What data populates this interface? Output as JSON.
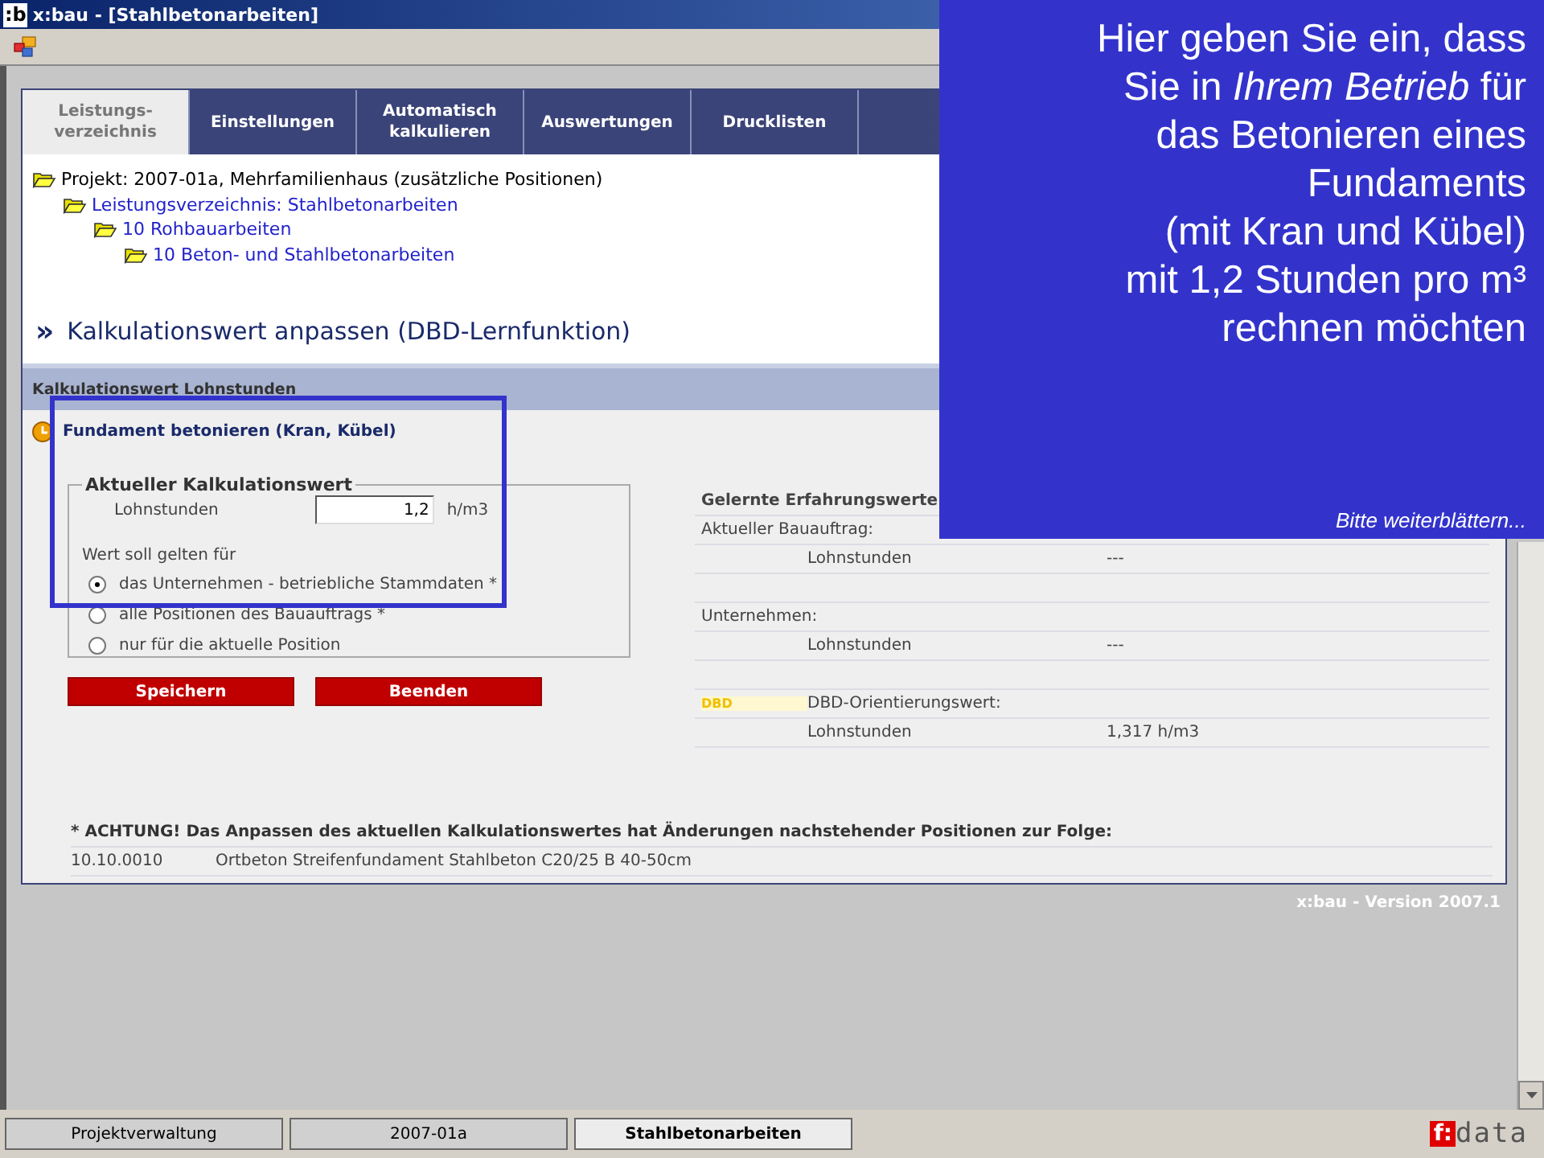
{
  "window": {
    "title": "x:bau - [Stahlbetonarbeiten]",
    "app_icon": ":b"
  },
  "tabs": [
    {
      "label": "Leistungs-\nverzeichnis",
      "selected": true
    },
    {
      "label": "Einstellungen",
      "selected": false
    },
    {
      "label": "Automatisch\nkalkulieren",
      "selected": false
    },
    {
      "label": "Auswertungen",
      "selected": false
    },
    {
      "label": "Drucklisten",
      "selected": false
    }
  ],
  "tree": [
    {
      "label": "Projekt: 2007-01a, Mehrfamilienhaus (zusätzliche Positionen)",
      "children": [
        {
          "label": "Leistungsverzeichnis: Stahlbetonarbeiten",
          "children": [
            {
              "label": "10 Rohbauarbeiten",
              "children": [
                {
                  "label": "10 Beton- und Stahlbetonarbeiten"
                }
              ]
            }
          ]
        }
      ]
    }
  ],
  "heading": {
    "marker": "»",
    "text": "Kalkulationswert anpassen (DBD-Lernfunktion)"
  },
  "section": {
    "title": "Kalkulationswert Lohnstunden"
  },
  "item_title": "Fundament betonieren (Kran, Kübel)",
  "form": {
    "legend": "Aktueller Kalkulationswert",
    "field_label": "Lohnstunden",
    "value": "1,2",
    "unit": "h/m3",
    "scope_label": "Wert soll gelten für",
    "options": [
      {
        "label": "das Unternehmen - betriebliche Stammdaten *",
        "selected": true
      },
      {
        "label": "alle Positionen des Bauauftrags *",
        "selected": false
      },
      {
        "label": "nur für die aktuelle Position",
        "selected": false
      }
    ]
  },
  "buttons": [
    "Speichern",
    "Beenden"
  ],
  "learned": {
    "title": "Gelernte Erfahrungswerte",
    "rows": [
      {
        "kind": "group",
        "label": "Aktueller Bauauftrag:"
      },
      {
        "kind": "value",
        "label": "Lohnstunden",
        "value": "---"
      },
      {
        "kind": "blank"
      },
      {
        "kind": "group",
        "label": "Unternehmen:"
      },
      {
        "kind": "value",
        "label": "Lohnstunden",
        "value": "---"
      },
      {
        "kind": "blank"
      },
      {
        "kind": "badge",
        "badge": "DBD",
        "label": "DBD-Orientierungswert:"
      },
      {
        "kind": "value",
        "label": "Lohnstunden",
        "value": "1,317  h/m3"
      }
    ]
  },
  "notice": "* ACHTUNG! Das Anpassen des aktuellen Kalkulationswertes hat Änderungen nachstehender Positionen zur Folge:",
  "affected": [
    {
      "number": "10.10.0010",
      "text": "Ortbeton Streifenfundament Stahlbeton C20/25 B 40-50cm"
    }
  ],
  "version": "x:bau - Version 2007.1",
  "taskbar": [
    {
      "label": "Projektverwaltung",
      "selected": false
    },
    {
      "label": "2007-01a",
      "selected": false
    },
    {
      "label": "Stahlbetonarbeiten",
      "selected": true
    }
  ],
  "logo": {
    "mark": "f:",
    "text": "data"
  },
  "callout": {
    "text": "Hier geben Sie ein, dass\nSie in *Ihrem Betrieb* für\ndas Betonieren eines\nFundaments\n(mit Kran und Kübel)\nmit 1,2 Stunden pro m³\nrechnen möchten",
    "footer": "Bitte weiterblättern..."
  }
}
